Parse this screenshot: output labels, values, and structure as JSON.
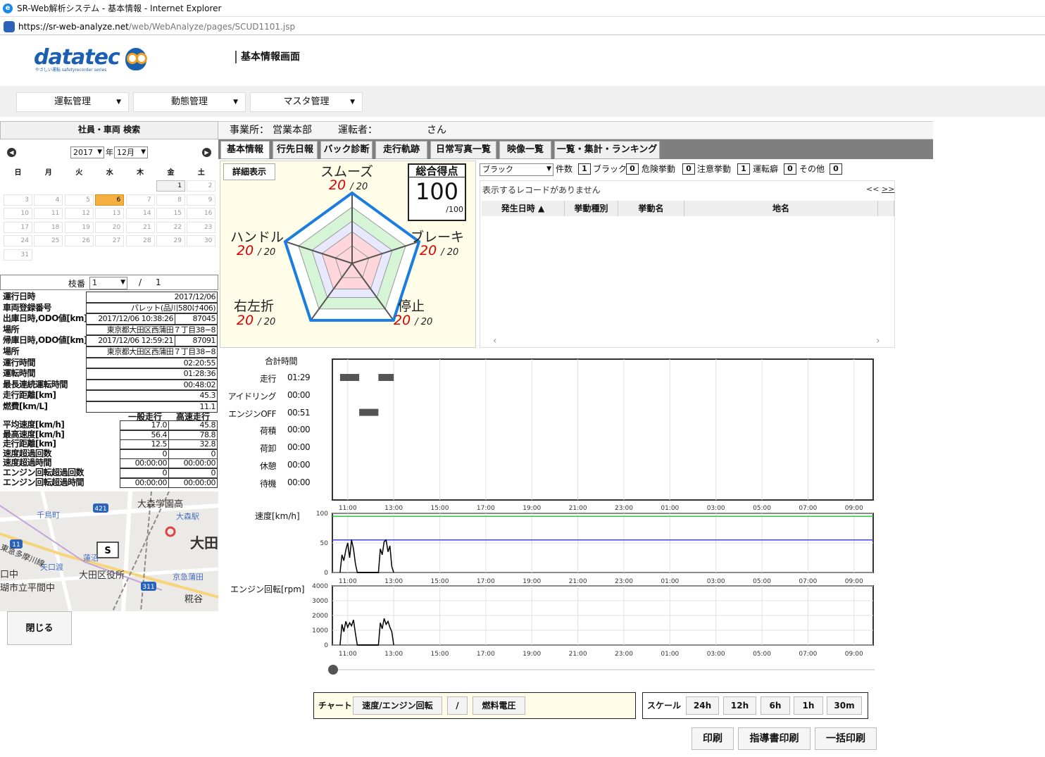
{
  "browser": {
    "title": "SR-Web解析システム - 基本情報 - Internet Explorer",
    "url_host": "https://sr-web-analyze.net",
    "url_path": "/web/WebAnalyze/pages/SCUD1101.jsp"
  },
  "header": {
    "logo": "datatec",
    "logo_sub": "やさしい運転 safetyrecorder series",
    "page_title": "基本情報画面"
  },
  "nav": [
    {
      "label": "運転管理"
    },
    {
      "label": "動態管理"
    },
    {
      "label": "マスタ管理"
    }
  ],
  "left": {
    "search_title": "社員・車両 検索",
    "calendar": {
      "year": "2017",
      "year_suffix": "年",
      "month": "12月",
      "dow": [
        "日",
        "月",
        "火",
        "水",
        "木",
        "金",
        "土"
      ],
      "days": [
        "",
        "",
        "",
        "",
        "",
        "1",
        "2",
        "3",
        "4",
        "5",
        "6",
        "7",
        "8",
        "9",
        "10",
        "11",
        "12",
        "13",
        "14",
        "15",
        "16",
        "17",
        "18",
        "19",
        "20",
        "21",
        "22",
        "23",
        "24",
        "25",
        "26",
        "27",
        "28",
        "29",
        "30",
        "31"
      ]
    },
    "branch": {
      "label": "枝番",
      "value": "1",
      "sep": "/",
      "total": "1"
    },
    "info": [
      {
        "label": "運行日時",
        "value": "2017/12/06"
      },
      {
        "label": "車両登録番号",
        "value": "パレット(品川580け406)"
      },
      {
        "label": "出庫日時,ODO値[km]",
        "value": "2017/12/06 10:38:26",
        "value2": "87045"
      },
      {
        "label": "場所",
        "value": "東京都大田区西蒲田７丁目38−8"
      },
      {
        "label": "帰庫日時,ODO値[km]",
        "value": "2017/12/06 12:59:21",
        "value2": "87091"
      },
      {
        "label": "場所",
        "value": "東京都大田区西蒲田７丁目38−8"
      },
      {
        "label": "運行時間",
        "value": "02:20:55"
      },
      {
        "label": "運転時間",
        "value": "01:28:36"
      },
      {
        "label": "最長連続運転時間",
        "value": "00:48:02"
      },
      {
        "label": "走行距離[km]",
        "value": "45.3"
      },
      {
        "label": "燃費[km/L]",
        "value": "11.1"
      }
    ],
    "speed_table": {
      "headers": [
        "一般走行",
        "高速走行"
      ],
      "rows": [
        {
          "label": "平均速度[km/h]",
          "v1": "17.0",
          "v2": "45.8"
        },
        {
          "label": "最高速度[km/h]",
          "v1": "56.4",
          "v2": "78.8"
        },
        {
          "label": "走行距離[km]",
          "v1": "12.5",
          "v2": "32.8"
        },
        {
          "label": "速度超過回数",
          "v1": "0",
          "v2": "0"
        },
        {
          "label": "速度超過時間",
          "v1": "00:00:00",
          "v2": "00:00:00"
        },
        {
          "label": "エンジン回転超過回数",
          "v1": "0",
          "v2": "0"
        },
        {
          "label": "エンジン回転超過時間",
          "v1": "00:00:00",
          "v2": "00:00:00"
        }
      ]
    },
    "map": {
      "labels": [
        "大森学園高",
        "大森駅",
        "大田",
        "千鳥町",
        "蓮沼",
        "矢口渡",
        "大田区役所",
        "京急蒲田",
        "糀谷",
        "口中",
        "瑚市立平間中",
        "421",
        "311",
        "11",
        "東急多摩川線",
        "S"
      ]
    },
    "close_label": "閉じる"
  },
  "main": {
    "office_label": "事業所：",
    "office": "営業本部",
    "driver_label": "運転者：",
    "driver_suffix": "さん",
    "tabs": [
      "基本情報",
      "行先日報",
      "バック診断",
      "走行軌跡",
      "日常写真一覧",
      "映像一覧",
      "一覧・集計・ランキング"
    ],
    "detail_label": "詳細表示",
    "total": {
      "title": "総合得点",
      "score": "100",
      "max": "/100"
    },
    "radar": [
      {
        "name": "スムーズ",
        "score": "20",
        "max": "/ 20"
      },
      {
        "name": "ブレーキ",
        "score": "20",
        "max": "/ 20"
      },
      {
        "name": "停止",
        "score": "20",
        "max": "/ 20"
      },
      {
        "name": "右左折",
        "score": "20",
        "max": "/ 20"
      },
      {
        "name": "ハンドル",
        "score": "20",
        "max": "/ 20"
      }
    ],
    "filter": {
      "select": "ブラック",
      "count_label": "件数",
      "items": [
        {
          "label": "ブラック",
          "count": "1"
        },
        {
          "label": "危険挙動",
          "count": "0"
        },
        {
          "label": "注意挙動",
          "count": "0"
        },
        {
          "label": "運転癖",
          "count": "1"
        },
        {
          "label": "その他",
          "count": "0"
        }
      ]
    },
    "records": {
      "empty": "表示するレコードがありません",
      "prev": "<<",
      "next": ">>",
      "columns": [
        "発生日時 ▲",
        "挙動種別",
        "挙動名",
        "地名"
      ]
    },
    "timeline": {
      "header": "合計時間",
      "rows": [
        {
          "label": "走行",
          "time": "01:29"
        },
        {
          "label": "アイドリング",
          "time": "00:00"
        },
        {
          "label": "エンジンOFF",
          "time": "00:51"
        },
        {
          "label": "荷積",
          "time": "00:00"
        },
        {
          "label": "荷卸",
          "time": "00:00"
        },
        {
          "label": "休憩",
          "time": "00:00"
        },
        {
          "label": "待機",
          "time": "00:00"
        }
      ]
    },
    "chart_controls": {
      "chart_label": "チャート",
      "buttons": [
        "速度/エンジン回転",
        "/",
        "燃料電圧"
      ],
      "scale_label": "スケール",
      "scales": [
        "24h",
        "12h",
        "6h",
        "1h",
        "30m"
      ]
    },
    "print_buttons": [
      "印刷",
      "指導書印刷",
      "一括印刷"
    ]
  },
  "chart_data": [
    {
      "type": "timeline",
      "x_ticks": [
        "11:00",
        "13:00",
        "15:00",
        "17:00",
        "19:00",
        "21:00",
        "23:00",
        "01:00",
        "03:00",
        "05:00",
        "07:00",
        "09:00"
      ],
      "categories": [
        "走行",
        "アイドリング",
        "エンジンOFF",
        "荷積",
        "荷卸",
        "休憩",
        "待機"
      ],
      "segments": [
        {
          "category": "走行",
          "start": "10:40",
          "end": "11:30"
        },
        {
          "category": "走行",
          "start": "12:20",
          "end": "13:00"
        },
        {
          "category": "エンジンOFF",
          "start": "11:30",
          "end": "12:20"
        }
      ]
    },
    {
      "type": "line",
      "ylabel": "速度[km/h]",
      "ylim": [
        0,
        100
      ],
      "yticks": [
        0,
        50,
        100
      ],
      "x_ticks": [
        "11:00",
        "13:00",
        "15:00",
        "17:00",
        "19:00",
        "21:00",
        "23:00",
        "01:00",
        "03:00",
        "05:00",
        "07:00",
        "09:00"
      ],
      "reference_lines": [
        {
          "value": 95,
          "color": "#2ecc40"
        },
        {
          "value": 55,
          "color": "#4040ff"
        }
      ],
      "series": [
        {
          "color": "#000000",
          "x": [
            "10:40",
            "10:45",
            "10:50",
            "10:55",
            "11:00",
            "11:05",
            "11:10",
            "11:15",
            "11:20",
            "11:25",
            "11:30",
            "12:20",
            "12:25",
            "12:30",
            "12:35",
            "12:40",
            "12:45",
            "12:50",
            "12:55",
            "13:00"
          ],
          "values": [
            0,
            30,
            20,
            38,
            50,
            25,
            55,
            40,
            15,
            0,
            0,
            0,
            40,
            30,
            52,
            55,
            35,
            45,
            10,
            0
          ]
        }
      ]
    },
    {
      "type": "line",
      "ylabel": "エンジン回転[rpm]",
      "ylim": [
        0,
        4000
      ],
      "yticks": [
        0,
        1000,
        2000,
        3000,
        4000
      ],
      "x_ticks": [
        "11:00",
        "13:00",
        "15:00",
        "17:00",
        "19:00",
        "21:00",
        "23:00",
        "01:00",
        "03:00",
        "05:00",
        "07:00",
        "09:00"
      ],
      "series": [
        {
          "color": "#000000",
          "x": [
            "10:40",
            "10:45",
            "10:50",
            "10:55",
            "11:00",
            "11:05",
            "11:10",
            "11:15",
            "11:20",
            "11:25",
            "11:30",
            "12:20",
            "12:25",
            "12:30",
            "12:35",
            "12:40",
            "12:45",
            "12:50",
            "12:55",
            "13:00"
          ],
          "values": [
            0,
            1400,
            900,
            1600,
            1200,
            1500,
            1300,
            1700,
            800,
            0,
            0,
            0,
            1500,
            1100,
            1800,
            1400,
            1600,
            1200,
            900,
            0
          ]
        }
      ]
    }
  ]
}
